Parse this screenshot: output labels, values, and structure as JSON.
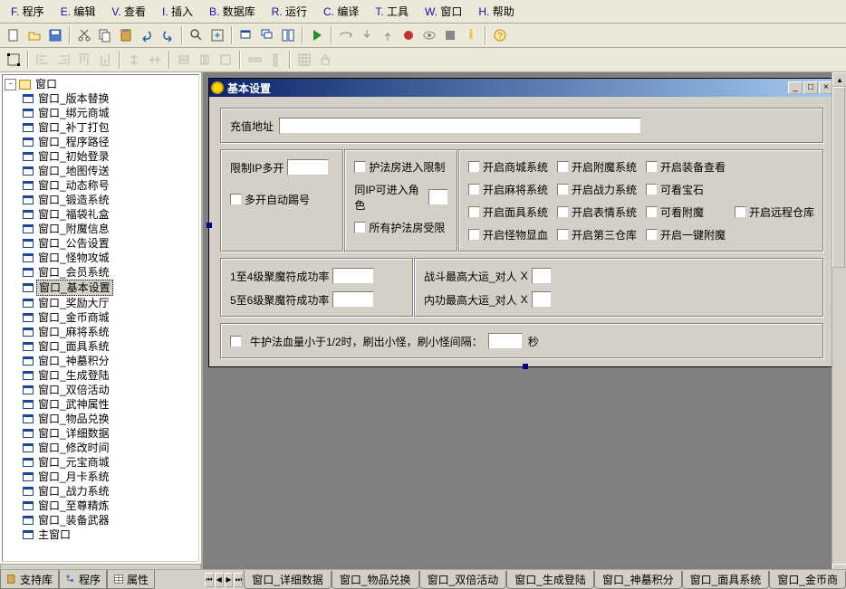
{
  "menu": [
    {
      "key": "F",
      "label": "程序"
    },
    {
      "key": "E",
      "label": "编辑"
    },
    {
      "key": "V",
      "label": "查看"
    },
    {
      "key": "I",
      "label": "插入"
    },
    {
      "key": "B",
      "label": "数据库"
    },
    {
      "key": "R",
      "label": "运行"
    },
    {
      "key": "C",
      "label": "编译"
    },
    {
      "key": "T",
      "label": "工具"
    },
    {
      "key": "W",
      "label": "窗口"
    },
    {
      "key": "H",
      "label": "帮助"
    }
  ],
  "tree": {
    "root": "窗口",
    "items": [
      "窗口_版本替换",
      "窗口_绑元商城",
      "窗口_补丁打包",
      "窗口_程序路径",
      "窗口_初始登录",
      "窗口_地图传送",
      "窗口_动态称号",
      "窗口_锻造系统",
      "窗口_福袋礼盒",
      "窗口_附魔信息",
      "窗口_公告设置",
      "窗口_怪物攻城",
      "窗口_会员系统",
      "窗口_基本设置",
      "窗口_奖励大厅",
      "窗口_金币商城",
      "窗口_麻将系统",
      "窗口_面具系统",
      "窗口_神墓积分",
      "窗口_生成登陆",
      "窗口_双倍活动",
      "窗口_武神属性",
      "窗口_物品兑换",
      "窗口_详细数据",
      "窗口_修改时间",
      "窗口_元宝商城",
      "窗口_月卡系统",
      "窗口_战力系统",
      "窗口_至尊精炼",
      "窗口_装备武器",
      "主窗口"
    ],
    "selected": "窗口_基本设置"
  },
  "form": {
    "title": "基本设置",
    "topup_label": "充值地址",
    "topup_value": "",
    "g1_ip_label": "限制IP多开",
    "g1_ip_value": "",
    "g1_autokick": "多开自动踢号",
    "g2": {
      "a": "护法房进入限制",
      "b_lbl": "同IP可进入角色",
      "b_val": "",
      "c": "所有护法房受限"
    },
    "g3": [
      "开启商城系统",
      "开启附魔系统",
      "开启装备查看",
      "开启麻将系统",
      "开启战力系统",
      "可看宝石",
      "开启面具系统",
      "开启表情系统",
      "可看附魔",
      "开启远程仓库",
      "开启怪物显血",
      "开启第三仓库",
      "开启一键附魔"
    ],
    "r3l": {
      "a_lbl": "1至4级聚魔符成功率",
      "a_val": "",
      "b_lbl": "5至6级聚魔符成功率",
      "b_val": ""
    },
    "r3r": {
      "a_lbl": "战斗最高大运_对人",
      "x": "X",
      "a_val": "",
      "b_lbl": "内功最高大运_对人",
      "b_val": ""
    },
    "r4": {
      "cb": "牛护法血量小于1/2时，刷出小怪，刷小怪间隔：",
      "val": "",
      "sec": "秒"
    }
  },
  "bottom_left": [
    {
      "icon": "book",
      "label": "支持库"
    },
    {
      "icon": "tree",
      "label": "程序"
    },
    {
      "icon": "prop",
      "label": "属性"
    }
  ],
  "bottom_right": [
    "窗口_详细数据",
    "窗口_物品兑换",
    "窗口_双倍活动",
    "窗口_生成登陆",
    "窗口_神墓积分",
    "窗口_面具系统",
    "窗口_金币商"
  ]
}
